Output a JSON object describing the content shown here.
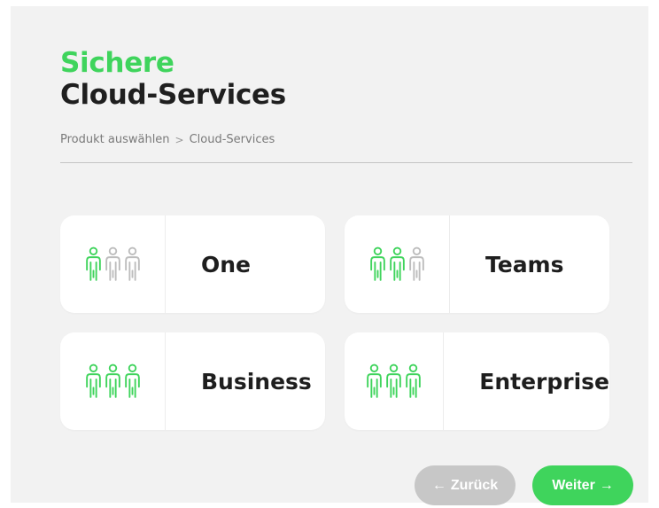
{
  "header": {
    "title_line1": "Sichere",
    "title_line2": "Cloud-Services"
  },
  "breadcrumb": {
    "items": [
      "Produkt auswählen",
      "Cloud-Services"
    ],
    "separator": ">"
  },
  "plans": [
    {
      "label": "One",
      "users_total": 3,
      "users_active": 1
    },
    {
      "label": "Teams",
      "users_total": 3,
      "users_active": 2
    },
    {
      "label": "Business",
      "users_total": 3,
      "users_active": 3
    },
    {
      "label": "Enterprise",
      "users_total": 3,
      "users_active": 3
    }
  ],
  "navigation": {
    "back_label": "Zurück",
    "back_arrow": "←",
    "next_label": "Weiter",
    "next_arrow": "→"
  },
  "colors": {
    "accent": "#3fd45c",
    "inactive_icon": "#bdbdbd",
    "background": "#f2f2f2",
    "card": "#ffffff",
    "button_disabled": "#c7c7c7"
  },
  "icons": {
    "user": "person-icon"
  }
}
